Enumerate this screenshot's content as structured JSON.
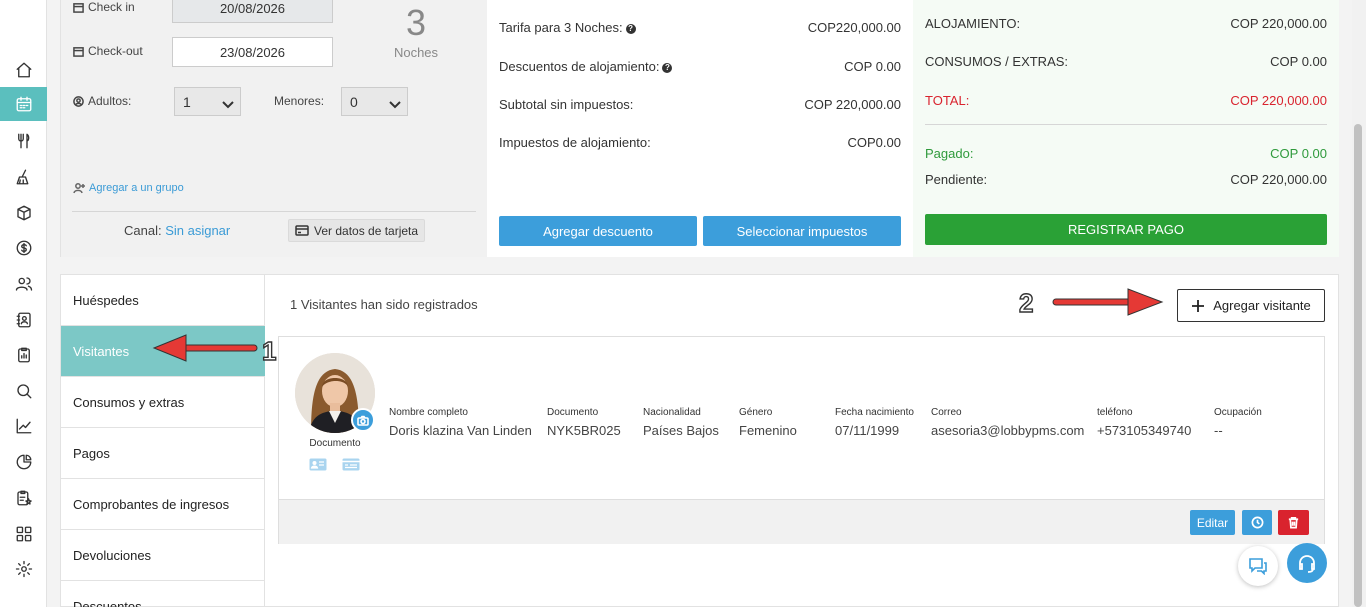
{
  "sidebar": {
    "active_item": "calendar",
    "items": [
      "home",
      "calendar",
      "restaurant",
      "housekeeping",
      "inventory",
      "billing",
      "guests",
      "contacts",
      "reports",
      "search",
      "analytics",
      "statistics",
      "tasks",
      "apps",
      "settings"
    ]
  },
  "stay": {
    "checkin_label": "Check in",
    "checkin_value": "20/08/2026",
    "checkout_label": "Check-out",
    "checkout_value": "23/08/2026",
    "nights_count": "3",
    "nights_label": "Noches",
    "adults_label": "Adultos:",
    "adults_value": "1",
    "minors_label": "Menores:",
    "minors_value": "0",
    "group_link": "Agregar a un grupo",
    "canal_label": "Canal:",
    "canal_value": "Sin asignar",
    "card_button": "Ver datos de tarjeta"
  },
  "rates": {
    "rows": [
      {
        "label": "Tarifa para 3 Noches:",
        "value": "COP220,000.00"
      },
      {
        "label": "Descuentos de alojamiento:",
        "value": "COP 0.00"
      },
      {
        "label": "Subtotal sin impuestos:",
        "value": "COP 220,000.00"
      },
      {
        "label": "Impuestos de alojamiento:",
        "value": "COP0.00"
      }
    ],
    "discount_button": "Agregar descuento",
    "taxes_button": "Seleccionar impuestos"
  },
  "summary": {
    "rows": [
      {
        "label": "ALOJAMIENTO:",
        "value": "COP 220,000.00"
      },
      {
        "label": "CONSUMOS / EXTRAS:",
        "value": "COP 0.00"
      },
      {
        "label": "TOTAL:",
        "value": "COP 220,000.00"
      },
      {
        "label": "Pagado:",
        "value": "COP 0.00"
      },
      {
        "label": "Pendiente:",
        "value": "COP 220,000.00"
      }
    ],
    "pay_button": "REGISTRAR PAGO"
  },
  "tabs": [
    "Huéspedes",
    "Visitantes",
    "Consumos y extras",
    "Pagos",
    "Comprobantes de ingresos",
    "Devoluciones",
    "Descuentos"
  ],
  "active_tab": "Visitantes",
  "visitors": {
    "count_text": "1 Visitantes han sido registrados",
    "add_button": "Agregar visitante",
    "card": {
      "document_label": "Documento",
      "fields": [
        {
          "label": "Nombre completo",
          "value": "Doris klazina Van Linden"
        },
        {
          "label": "Documento",
          "value": "NYK5BR025"
        },
        {
          "label": "Nacionalidad",
          "value": "Países Bajos"
        },
        {
          "label": "Género",
          "value": "Femenino"
        },
        {
          "label": "Fecha nacimiento",
          "value": "07/11/1999"
        },
        {
          "label": "Correo",
          "value": "asesoria3@lobbypms.com"
        },
        {
          "label": "teléfono",
          "value": "+573105349740"
        },
        {
          "label": "Ocupación",
          "value": "--"
        }
      ],
      "edit_button": "Editar"
    }
  },
  "annotations": {
    "one": "1",
    "two": "2"
  },
  "colors": {
    "teal": "#5bbfbe",
    "blue": "#3c9edb",
    "green": "#2aa136",
    "red": "#d9232e"
  }
}
